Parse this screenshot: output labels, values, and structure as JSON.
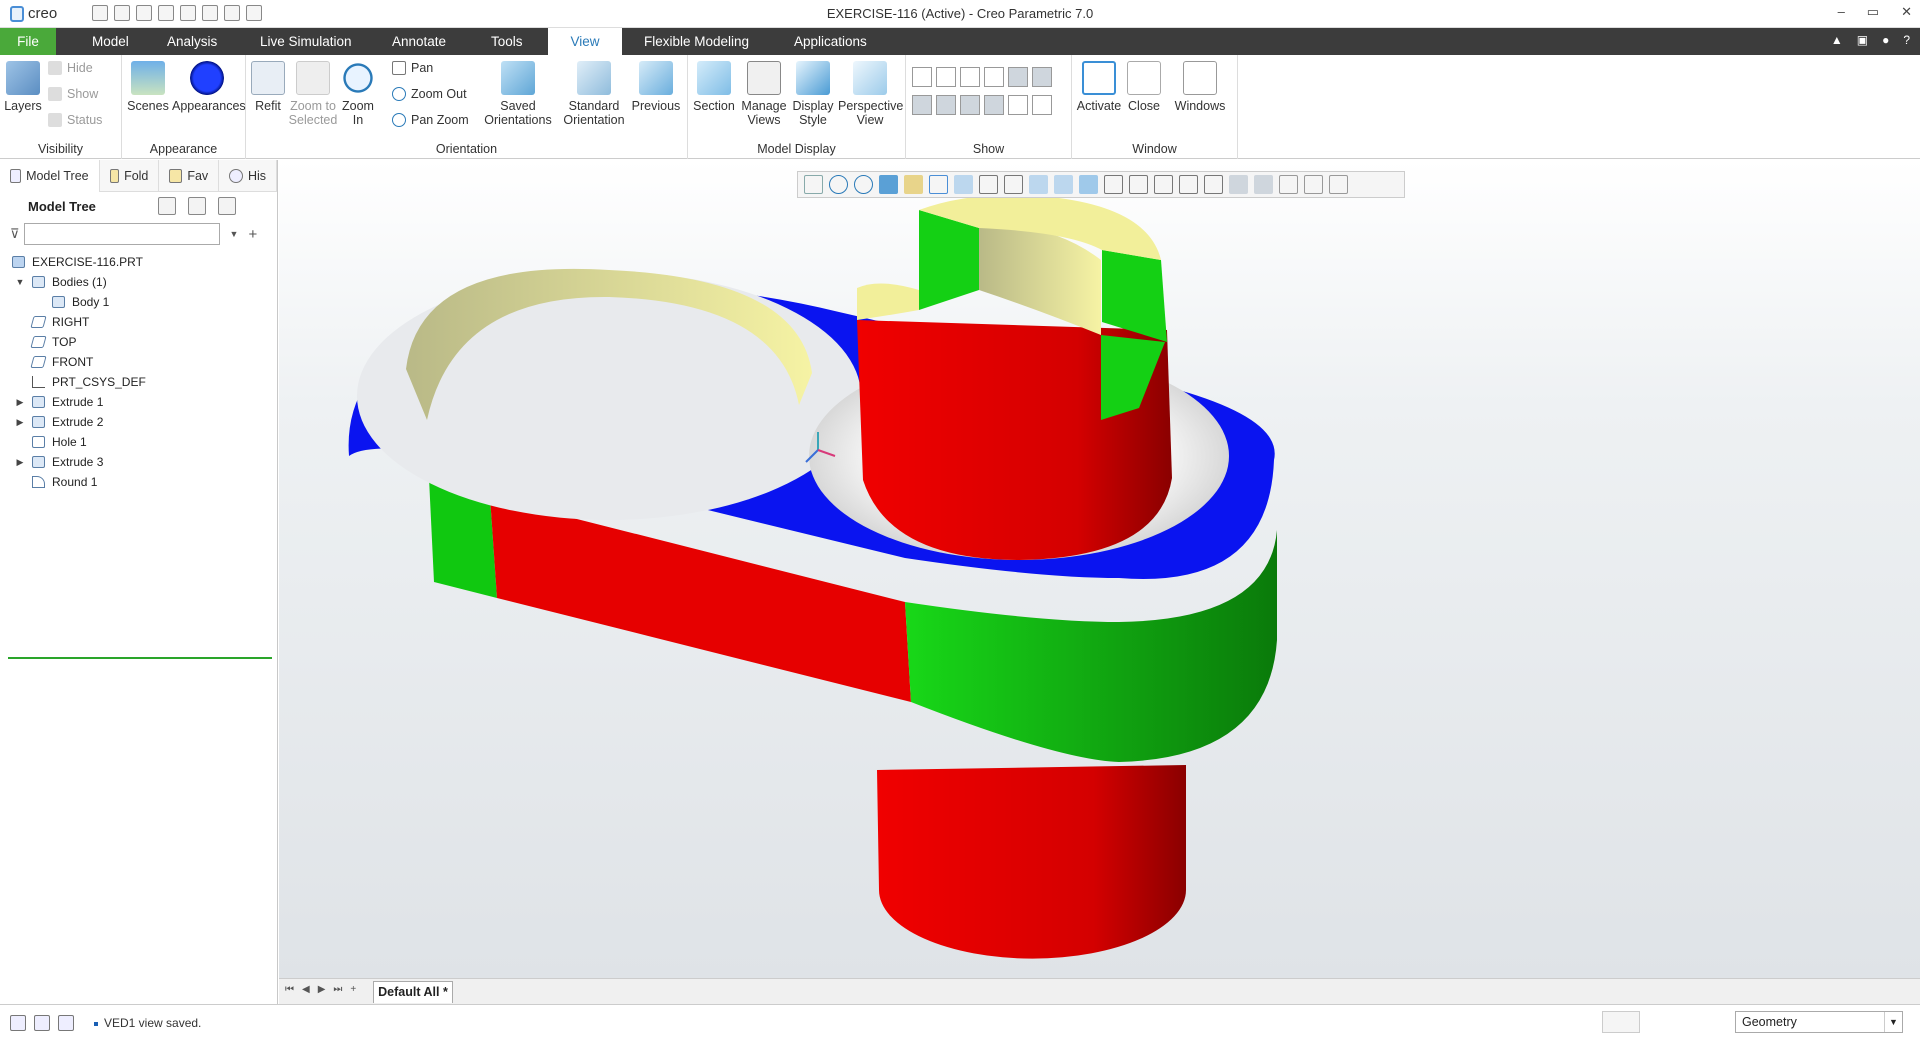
{
  "app": {
    "logo_text": "creo",
    "window_title": "EXERCISE-116 (Active) - Creo Parametric 7.0",
    "window_buttons": [
      "–",
      "▭",
      "✕"
    ]
  },
  "ribbon_tabs": [
    {
      "label": "File"
    },
    {
      "label": "Model"
    },
    {
      "label": "Analysis"
    },
    {
      "label": "Live Simulation"
    },
    {
      "label": "Annotate"
    },
    {
      "label": "Tools"
    },
    {
      "label": "View",
      "active": true
    },
    {
      "label": "Flexible Modeling"
    },
    {
      "label": "Applications"
    }
  ],
  "tab_right_icons": [
    "▲",
    "▣",
    "●",
    "?"
  ],
  "ribbon": {
    "visibility": {
      "group_label": "Visibility",
      "layers": "Layers",
      "hide": "Hide",
      "show": "Show",
      "status": "Status"
    },
    "appearance": {
      "group_label": "Appearance",
      "scenes": "Scenes",
      "appearances": "Appearances"
    },
    "orientation": {
      "group_label": "Orientation",
      "refit": "Refit",
      "zoom_to_selected_1": "Zoom to",
      "zoom_to_selected_2": "Selected",
      "zoom_in_1": "Zoom",
      "zoom_in_2": "In",
      "pan": "Pan",
      "zoom_out": "Zoom Out",
      "pan_zoom": "Pan Zoom",
      "saved_orientations_1": "Saved",
      "saved_orientations_2": "Orientations",
      "standard_orientation_1": "Standard",
      "standard_orientation_2": "Orientation",
      "previous": "Previous"
    },
    "model_display": {
      "group_label": "Model Display",
      "section": "Section",
      "manage_views_1": "Manage",
      "manage_views_2": "Views",
      "display_style_1": "Display",
      "display_style_2": "Style",
      "perspective_view_1": "Perspective",
      "perspective_view_2": "View"
    },
    "show": {
      "group_label": "Show"
    },
    "window": {
      "group_label": "Window",
      "activate": "Activate",
      "close": "Close",
      "windows": "Windows"
    }
  },
  "navigator": {
    "tabs": [
      {
        "label": "Model Tree"
      },
      {
        "label": "Fold"
      },
      {
        "label": "Fav"
      },
      {
        "label": "His"
      }
    ],
    "tree_title": "Model Tree",
    "filter_placeholder": "",
    "items": [
      {
        "label": "EXERCISE-116.PRT",
        "indent": 0,
        "expander": ""
      },
      {
        "label": "Bodies (1)",
        "indent": 1,
        "expander": "▼"
      },
      {
        "label": "Body 1",
        "indent": 2,
        "expander": ""
      },
      {
        "label": "RIGHT",
        "indent": 1,
        "expander": ""
      },
      {
        "label": "TOP",
        "indent": 1,
        "expander": ""
      },
      {
        "label": "FRONT",
        "indent": 1,
        "expander": ""
      },
      {
        "label": "PRT_CSYS_DEF",
        "indent": 1,
        "expander": ""
      },
      {
        "label": "Extrude 1",
        "indent": 1,
        "expander": "▶"
      },
      {
        "label": "Extrude 2",
        "indent": 1,
        "expander": "▶"
      },
      {
        "label": "Hole 1",
        "indent": 1,
        "expander": ""
      },
      {
        "label": "Extrude 3",
        "indent": 1,
        "expander": "▶"
      },
      {
        "label": "Round 1",
        "indent": 1,
        "expander": ""
      }
    ]
  },
  "bottom_tabs": {
    "sheet": "Default All *"
  },
  "status": {
    "message": "VED1 view saved.",
    "selection_filter": "Geometry"
  },
  "colors": {
    "file_tab": "#4aa93a",
    "ribbon_bar": "#3c3c3c",
    "active_tab_text": "#2a7ab8",
    "model_blue": "#0a14f0",
    "model_green": "#16d016",
    "model_red": "#e00000",
    "model_yellow": "#f2ef9a"
  }
}
